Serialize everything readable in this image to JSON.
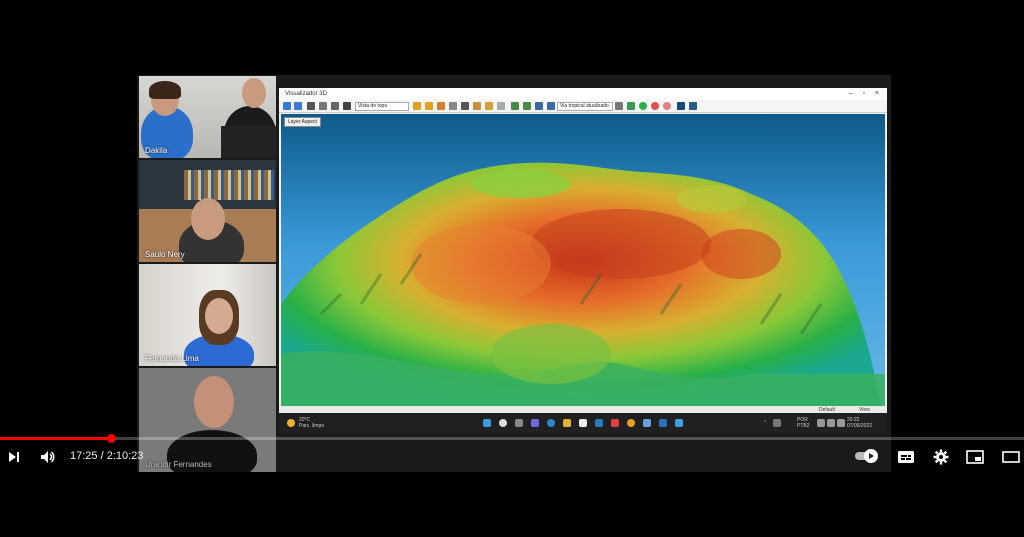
{
  "video": {
    "time_current": "17:25",
    "time_separator": " / ",
    "time_total": "2:10:23",
    "progress_fraction": 0.108
  },
  "participants": [
    {
      "name": "Dakila"
    },
    {
      "name": "Saulo Nery"
    },
    {
      "name": "Fernanda Lima"
    },
    {
      "name": "Urandir Fernandes"
    }
  ],
  "app": {
    "title": "Visualizador 3D",
    "map_select": "Vista de topo",
    "texture_select": "Via tropical atualizado",
    "layer_button": "Layer Aspect",
    "status_left": "Default",
    "status_right": "View"
  },
  "taskbar": {
    "weather_temp": "20°C",
    "weather_desc": "Parc. limpo",
    "lang": "POR",
    "lang2": "PTB2",
    "clock_time": "20:22",
    "clock_date": "07/06/2022"
  },
  "icons": {
    "play": "skip-next-icon",
    "volume": "volume-icon",
    "autoplay": "autoplay-toggle",
    "subtitles": "subtitles-icon",
    "settings": "gear-icon",
    "miniplayer": "miniplayer-icon",
    "theater": "theater-icon"
  }
}
